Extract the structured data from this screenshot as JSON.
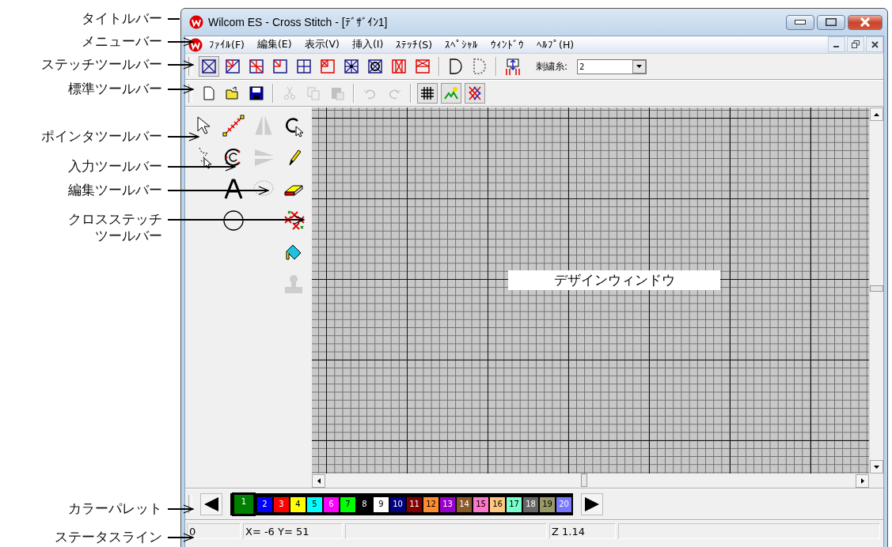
{
  "callouts": [
    {
      "lines": [
        "タイトルバー"
      ],
      "arrow": false
    },
    {
      "lines": [
        "メニューバー"
      ],
      "arrow": true
    },
    {
      "lines": [
        "ステッチツールバー"
      ],
      "arrow": true
    },
    {
      "lines": [
        "標準ツールバー"
      ],
      "arrow": true
    },
    {
      "lines": [
        "ポインタツールバー"
      ],
      "arrow": true
    },
    {
      "lines": [
        "入力ツールバー"
      ],
      "arrow": true
    },
    {
      "lines": [
        "編集ツールバー"
      ],
      "arrow": true
    },
    {
      "lines": [
        "クロスステッチ",
        "ツールバー"
      ],
      "arrow": true
    },
    {
      "lines": [
        "カラーパレット"
      ],
      "arrow": true
    },
    {
      "lines": [
        "ステータスライン"
      ],
      "arrow": true
    }
  ],
  "window": {
    "title": "Wilcom ES - Cross Stitch - [ﾃﾞｻﾞｲﾝ1]"
  },
  "menu": [
    "ﾌｧｲﾙ(F)",
    "編集(E)",
    "表示(V)",
    "挿入(I)",
    "ｽﾃｯﾁ(S)",
    "ｽﾍﾟｼｬﾙ",
    "ｳｨﾝﾄﾞｳ",
    "ﾍﾙﾌﾟ(H)"
  ],
  "stitch_toolbar": {
    "tools": [
      {
        "kind": "full",
        "selected": true
      },
      {
        "kind": "three_quarter",
        "selected": false
      },
      {
        "kind": "quarter_split",
        "selected": false
      },
      {
        "kind": "corner",
        "selected": false
      },
      {
        "kind": "cross_quad",
        "selected": false
      },
      {
        "kind": "corner_x",
        "selected": false
      },
      {
        "kind": "star",
        "selected": false
      },
      {
        "kind": "ring",
        "selected": false
      },
      {
        "kind": "petite",
        "selected": false
      },
      {
        "kind": "top_x",
        "selected": false
      }
    ],
    "thread_label": "刺繍糸:",
    "thread_value": "2"
  },
  "standard_toolbar": [
    {
      "kind": "new",
      "disabled": false,
      "pressed": false
    },
    {
      "kind": "open",
      "disabled": false,
      "pressed": false
    },
    {
      "kind": "save",
      "disabled": false,
      "pressed": false
    },
    {
      "kind": "cut",
      "disabled": true,
      "pressed": false
    },
    {
      "kind": "copy",
      "disabled": true,
      "pressed": false
    },
    {
      "kind": "paste",
      "disabled": true,
      "pressed": false
    },
    {
      "kind": "undo",
      "disabled": true,
      "pressed": false
    },
    {
      "kind": "redo",
      "disabled": true,
      "pressed": false
    },
    {
      "kind": "grid",
      "disabled": false,
      "pressed": true
    },
    {
      "kind": "picture",
      "disabled": false,
      "pressed": true
    },
    {
      "kind": "cross",
      "disabled": false,
      "pressed": true
    }
  ],
  "tool_columns": [
    [
      {
        "kind": "pointer",
        "disabled": false
      },
      {
        "kind": "select_area",
        "disabled": false
      }
    ],
    [
      {
        "kind": "stitch_line",
        "disabled": false
      },
      {
        "kind": "c_shape",
        "disabled": false
      },
      {
        "kind": "text",
        "disabled": false
      },
      {
        "kind": "circle",
        "disabled": false
      }
    ],
    [
      {
        "kind": "mirror_v",
        "disabled": true
      },
      {
        "kind": "mirror_h",
        "disabled": true
      },
      {
        "kind": "oval",
        "disabled": true
      }
    ],
    [
      {
        "kind": "lasso",
        "disabled": false
      },
      {
        "kind": "pencil",
        "disabled": false
      },
      {
        "kind": "eraser",
        "disabled": false
      },
      {
        "kind": "flowers",
        "disabled": false
      },
      {
        "kind": "bucket",
        "disabled": false
      },
      {
        "kind": "stamp",
        "disabled": true
      }
    ]
  ],
  "design_window": {
    "label": "デザインウィンドウ"
  },
  "palette": [
    {
      "number": "1",
      "color": "#008000",
      "selected": true
    },
    {
      "number": "2",
      "color": "#0000ff",
      "selected": false
    },
    {
      "number": "3",
      "color": "#ff0000",
      "selected": false
    },
    {
      "number": "4",
      "color": "#ffff00",
      "selected": false
    },
    {
      "number": "5",
      "color": "#00ffff",
      "selected": false
    },
    {
      "number": "6",
      "color": "#ff00ff",
      "selected": false
    },
    {
      "number": "7",
      "color": "#00ff00",
      "selected": false
    },
    {
      "number": "8",
      "color": "#000000",
      "selected": false
    },
    {
      "number": "9",
      "color": "#ffffff",
      "selected": false
    },
    {
      "number": "10",
      "color": "#000080",
      "selected": false
    },
    {
      "number": "11",
      "color": "#800000",
      "selected": false
    },
    {
      "number": "12",
      "color": "#ff8c32",
      "selected": false
    },
    {
      "number": "13",
      "color": "#9900cc",
      "selected": false
    },
    {
      "number": "14",
      "color": "#8b5a2b",
      "selected": false
    },
    {
      "number": "15",
      "color": "#ff77c8",
      "selected": false
    },
    {
      "number": "16",
      "color": "#ffc880",
      "selected": false
    },
    {
      "number": "17",
      "color": "#77ffcc",
      "selected": false
    },
    {
      "number": "18",
      "color": "#666666",
      "selected": false
    },
    {
      "number": "19",
      "color": "#999966",
      "selected": false
    },
    {
      "number": "20",
      "color": "#7777ff",
      "selected": false
    }
  ],
  "status": [
    "0",
    "X= -6  Y= 51",
    "Z 1.14"
  ]
}
